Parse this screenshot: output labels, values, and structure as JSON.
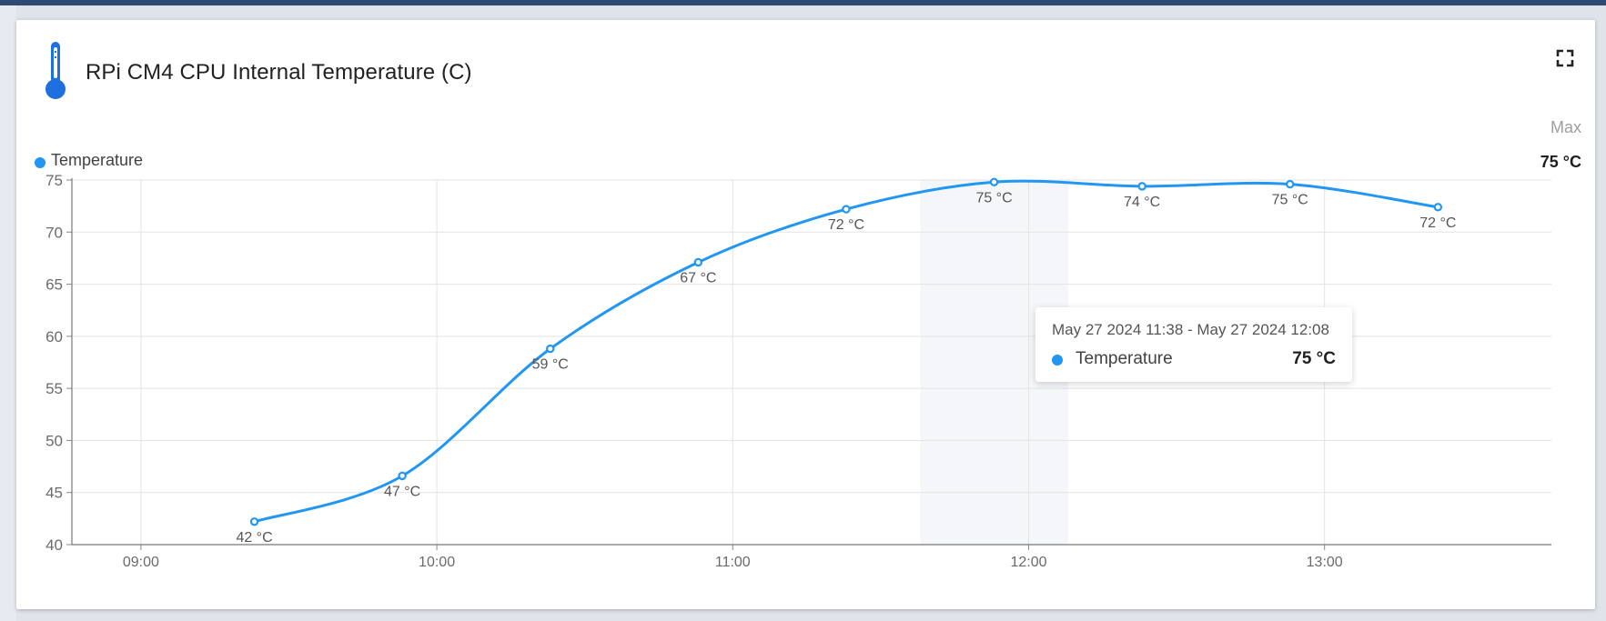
{
  "card": {
    "title": "RPi CM4 CPU Internal Temperature (C)",
    "icon": "thermometer-icon",
    "fullscreen_icon": "fullscreen-icon"
  },
  "legend": {
    "series_name": "Temperature",
    "color": "#2196f3"
  },
  "max": {
    "label": "Max",
    "value": "75 °C"
  },
  "tooltip": {
    "range": "May 27 2024 11:38 - May 27 2024 12:08",
    "series": "Temperature",
    "value": "75 °C"
  },
  "chart_data": {
    "type": "line",
    "title": "",
    "xlabel": "",
    "ylabel": "",
    "ylim": [
      40,
      75
    ],
    "xlim": [
      "08:46",
      "13:46"
    ],
    "y_ticks": [
      40,
      45,
      50,
      55,
      60,
      65,
      70,
      75
    ],
    "x_ticks": [
      "09:00",
      "10:00",
      "11:00",
      "12:00",
      "13:00"
    ],
    "grid": true,
    "legend_position": "top-left",
    "highlight_range": [
      "11:38",
      "12:08"
    ],
    "series": [
      {
        "name": "Temperature",
        "color": "#2196f3",
        "points": [
          {
            "x": "09:23",
            "y": 42.2,
            "label": "42 °C"
          },
          {
            "x": "09:53",
            "y": 46.6,
            "label": "47 °C"
          },
          {
            "x": "10:23",
            "y": 58.8,
            "label": "59 °C"
          },
          {
            "x": "10:53",
            "y": 67.1,
            "label": "67 °C"
          },
          {
            "x": "11:23",
            "y": 72.2,
            "label": "72 °C"
          },
          {
            "x": "11:53",
            "y": 74.8,
            "label": "75 °C"
          },
          {
            "x": "12:23",
            "y": 74.4,
            "label": "74 °C"
          },
          {
            "x": "12:53",
            "y": 74.6,
            "label": "75 °C"
          },
          {
            "x": "13:23",
            "y": 72.4,
            "label": "72 °C"
          }
        ]
      }
    ]
  }
}
